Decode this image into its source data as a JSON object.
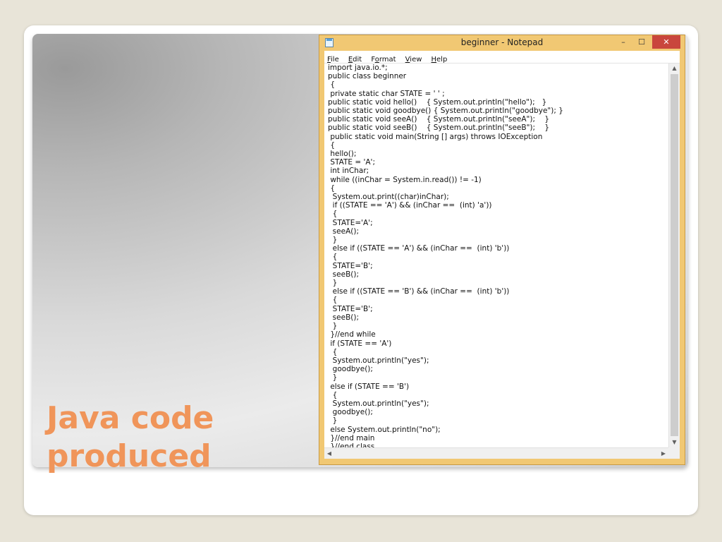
{
  "slide": {
    "title_lines": [
      "Java code",
      "produced"
    ]
  },
  "window": {
    "title": "beginner - Notepad",
    "controls": {
      "minimize": "–",
      "maximize": "☐",
      "close": "✕"
    }
  },
  "menu": [
    {
      "key": "F",
      "rest": "ile"
    },
    {
      "key": "E",
      "rest": "dit"
    },
    {
      "key": "",
      "pre": "F",
      "key2": "o",
      "rest": "rmat"
    },
    {
      "key": "V",
      "rest": "iew"
    },
    {
      "key": "H",
      "rest": "elp"
    }
  ],
  "menu_labels": {
    "file": "File",
    "edit": "Edit",
    "format": "Format",
    "view": "View",
    "help": "Help"
  },
  "code": "import java.io.*;\npublic class beginner\n {\n private static char STATE = ' ' ;\npublic static void hello()    { System.out.println(\"hello\");   }\npublic static void goodbye() { System.out.println(\"goodbye\"); }\npublic static void seeA()    { System.out.println(\"seeA\");    }\npublic static void seeB()    { System.out.println(\"seeB\");    }\n public static void main(String [] args) throws IOException\n {\n hello();\n STATE = 'A';\n int inChar;\n while ((inChar = System.in.read()) != -1)\n {\n  System.out.print((char)inChar);\n  if ((STATE == 'A') && (inChar ==  (int) 'a'))\n  {\n  STATE='A';\n  seeA();\n  }\n  else if ((STATE == 'A') && (inChar ==  (int) 'b'))\n  {\n  STATE='B';\n  seeB();\n  }\n  else if ((STATE == 'B') && (inChar ==  (int) 'b'))\n  {\n  STATE='B';\n  seeB();\n  }\n }//end while\n if (STATE == 'A')\n  {\n  System.out.println(\"yes\");\n  goodbye();\n  }\n else if (STATE == 'B')\n  {\n  System.out.println(\"yes\");\n  goodbye();\n  }\n else System.out.println(\"no\");\n }//end main\n }//end class",
  "colors": {
    "title_accent": "#f0955a",
    "window_frame": "#f1c873",
    "close_button": "#c9463d"
  },
  "icons": {
    "app": "notepad-icon",
    "scroll_up": "chevron-up-icon",
    "scroll_down": "chevron-down-icon",
    "scroll_left": "chevron-left-icon",
    "scroll_right": "chevron-right-icon"
  }
}
